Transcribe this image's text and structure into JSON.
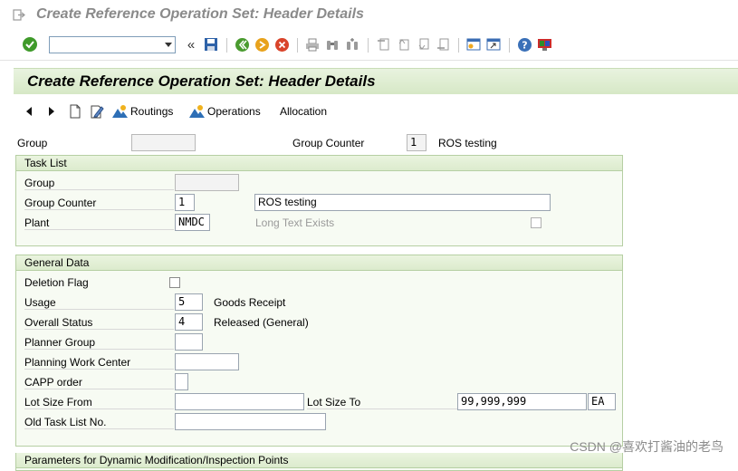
{
  "window": {
    "title": "Create Reference Operation Set: Header Details"
  },
  "screen_header": "Create Reference Operation Set: Header Details",
  "app_toolbar": {
    "routings_label": "Routings",
    "operations_label": "Operations",
    "allocation_label": "Allocation"
  },
  "header": {
    "group_label": "Group",
    "group_value": "",
    "group_counter_label": "Group Counter",
    "group_counter_value": "1",
    "group_counter_text": "ROS testing"
  },
  "task_list": {
    "title": "Task List",
    "group_label": "Group",
    "group_value": "",
    "group_counter_label": "Group Counter",
    "group_counter_value": "1",
    "description_value": "ROS testing",
    "plant_label": "Plant",
    "plant_value": "NMDC",
    "long_text_label": "Long Text Exists"
  },
  "general_data": {
    "title": "General Data",
    "deletion_flag_label": "Deletion Flag",
    "usage_label": "Usage",
    "usage_value": "5",
    "usage_text": "Goods Receipt",
    "overall_status_label": "Overall Status",
    "overall_status_value": "4",
    "overall_status_text": "Released (General)",
    "planner_group_label": "Planner Group",
    "planner_group_value": "",
    "planning_wc_label": "Planning Work Center",
    "planning_wc_value": "",
    "capp_label": "CAPP order",
    "capp_value": "",
    "lot_from_label": "Lot Size From",
    "lot_from_value": "",
    "lot_to_label": "Lot Size To",
    "lot_to_value": "99,999,999",
    "unit_value": "EA",
    "old_task_label": "Old Task List No.",
    "old_task_value": ""
  },
  "params_section": {
    "title": "Parameters for Dynamic Modification/Inspection Points"
  },
  "watermark": "CSDN @喜欢打酱油的老鸟"
}
